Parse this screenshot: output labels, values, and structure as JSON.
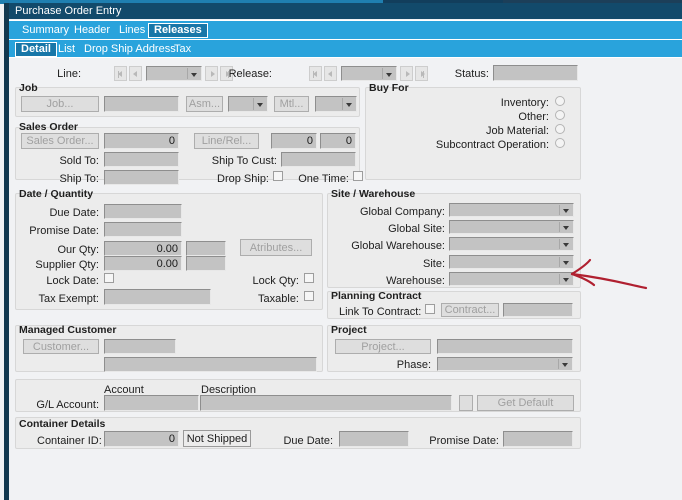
{
  "window": {
    "title": "Purchase Order Entry"
  },
  "tabs": {
    "primary": [
      {
        "label": "Summary",
        "active": false
      },
      {
        "label": "Header",
        "active": false
      },
      {
        "label": "Lines",
        "active": false
      },
      {
        "label": "Releases",
        "active": true
      }
    ],
    "secondary": [
      {
        "label": "Detail",
        "active": true
      },
      {
        "label": "List",
        "active": false
      },
      {
        "label": "Drop Ship Address",
        "active": false
      },
      {
        "label": "Tax",
        "active": false
      }
    ]
  },
  "navbar": {
    "line_label": "Line:",
    "line_value": "",
    "release_label": "Release:",
    "release_value": "",
    "status_label": "Status:",
    "status_value": ""
  },
  "job": {
    "title": "Job",
    "job_button": "Job...",
    "job_value": "",
    "asm_button": "Asm...",
    "asm_value": "",
    "mtl_button": "Mtl...",
    "mtl_value": ""
  },
  "buy_for": {
    "title": "Buy For",
    "options": [
      {
        "label": "Inventory:",
        "selected": false
      },
      {
        "label": "Other:",
        "selected": false
      },
      {
        "label": "Job Material:",
        "selected": false
      },
      {
        "label": "Subcontract Operation:",
        "selected": false
      }
    ]
  },
  "sales_order": {
    "title": "Sales Order",
    "sales_order_button": "Sales Order...",
    "sales_order_value": "0",
    "line_rel_button": "Line/Rel...",
    "line_value": "0",
    "rel_value": "0",
    "sold_to_label": "Sold To:",
    "sold_to_value": "",
    "ship_to_cust_label": "Ship To Cust:",
    "ship_to_cust_value": "",
    "ship_to_label": "Ship To:",
    "ship_to_value": "",
    "drop_ship_label": "Drop Ship:",
    "drop_ship_checked": false,
    "one_time_label": "One Time:",
    "one_time_checked": false
  },
  "date_quantity": {
    "title": "Date / Quantity",
    "due_date_label": "Due Date:",
    "due_date_value": "",
    "promise_date_label": "Promise Date:",
    "promise_date_value": "",
    "our_qty_label": "Our Qty:",
    "our_qty_value": "0.00",
    "our_uom_value": "",
    "supplier_qty_label": "Supplier Qty:",
    "supplier_qty_value": "0.00",
    "supplier_uom_value": "",
    "attributes_button": "Atributes...",
    "lock_date_label": "Lock Date:",
    "lock_date_checked": false,
    "lock_qty_label": "Lock Qty:",
    "lock_qty_checked": false,
    "tax_exempt_label": "Tax Exempt:",
    "tax_exempt_value": "",
    "taxable_label": "Taxable:",
    "taxable_checked": false
  },
  "site_warehouse": {
    "title": "Site / Warehouse",
    "fields": [
      {
        "label": "Global Company:",
        "value": ""
      },
      {
        "label": "Global Site:",
        "value": ""
      },
      {
        "label": "Global Warehouse:",
        "value": ""
      },
      {
        "label": "Site:",
        "value": ""
      },
      {
        "label": "Warehouse:",
        "value": ""
      }
    ]
  },
  "planning_contract": {
    "title": "Planning Contract",
    "link_label": "Link To Contract:",
    "link_checked": false,
    "contract_button": "Contract...",
    "contract_value": ""
  },
  "managed_customer": {
    "title": "Managed Customer",
    "customer_button": "Customer...",
    "customer_value": "",
    "customer_name_value": ""
  },
  "project": {
    "title": "Project",
    "project_button": "Project...",
    "project_value": "",
    "phase_label": "Phase:",
    "phase_value": ""
  },
  "gl_account": {
    "account_header": "Account",
    "description_header": "Description",
    "label": "G/L Account:",
    "account_value": "",
    "description_value": "",
    "get_default_button": "Get Default"
  },
  "container_details": {
    "title": "Container Details",
    "container_id_label": "Container ID:",
    "container_id_value": "0",
    "not_shipped_button": "Not Shipped",
    "due_date_label": "Due Date:",
    "due_date_value": "",
    "promise_date_label": "Promise Date:",
    "promise_date_value": ""
  },
  "annotation": {
    "color": "#b02030",
    "points_at": "warehouse-combo"
  }
}
